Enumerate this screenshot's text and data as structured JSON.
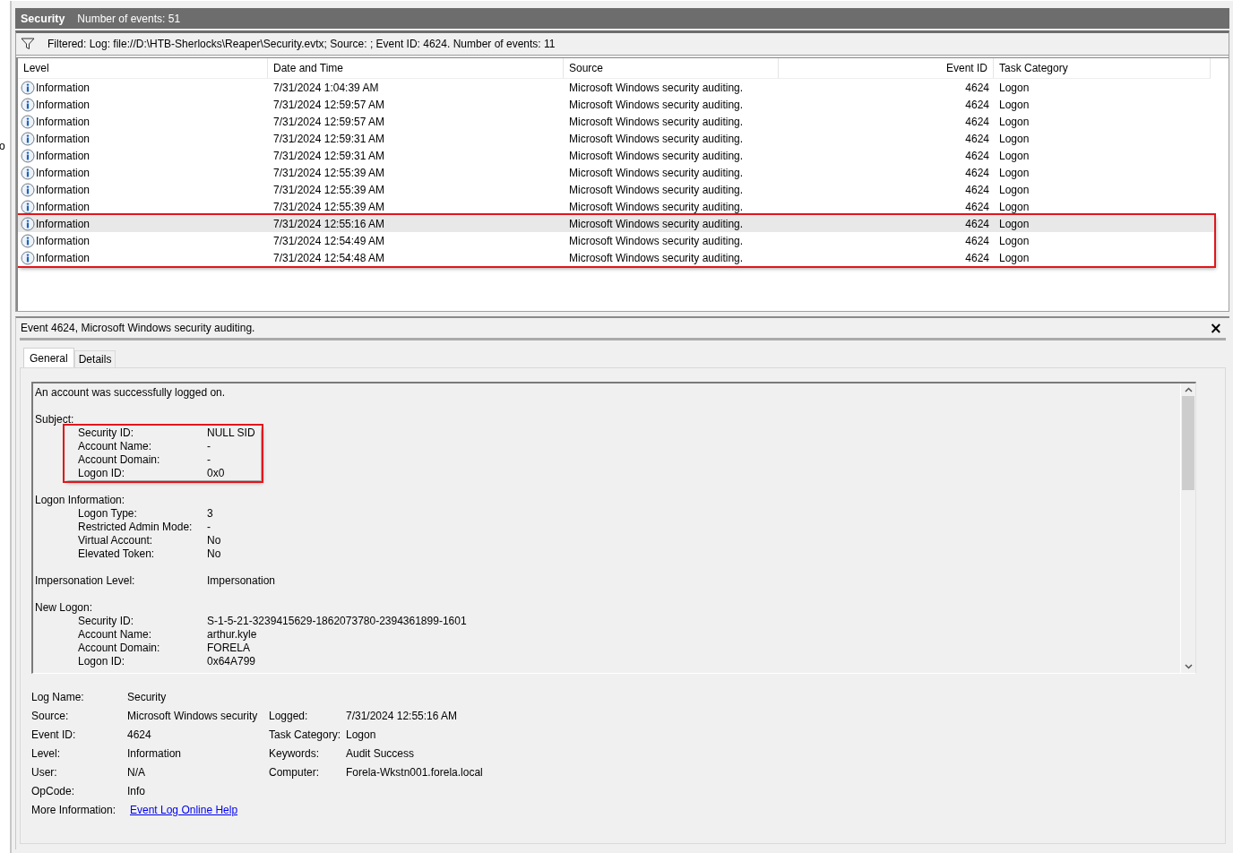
{
  "left_pane": {
    "fragment": "o"
  },
  "log_header": {
    "title": "Security",
    "count": "Number of events: 51"
  },
  "filter_bar": {
    "text": "Filtered: Log: file://D:\\HTB-Sherlocks\\Reaper\\Security.evtx; Source: ; Event ID: 4624. Number of events: 11"
  },
  "table": {
    "columns": [
      "Level",
      "Date and Time",
      "Source",
      "Event ID",
      "Task Category"
    ],
    "rows": [
      {
        "level": "Information",
        "date": "7/31/2024 1:04:39 AM",
        "source": "Microsoft Windows security auditing.",
        "event_id": "4624",
        "category": "Logon",
        "selected": false,
        "highlighted": false
      },
      {
        "level": "Information",
        "date": "7/31/2024 12:59:57 AM",
        "source": "Microsoft Windows security auditing.",
        "event_id": "4624",
        "category": "Logon",
        "selected": false,
        "highlighted": false
      },
      {
        "level": "Information",
        "date": "7/31/2024 12:59:57 AM",
        "source": "Microsoft Windows security auditing.",
        "event_id": "4624",
        "category": "Logon",
        "selected": false,
        "highlighted": false
      },
      {
        "level": "Information",
        "date": "7/31/2024 12:59:31 AM",
        "source": "Microsoft Windows security auditing.",
        "event_id": "4624",
        "category": "Logon",
        "selected": false,
        "highlighted": false
      },
      {
        "level": "Information",
        "date": "7/31/2024 12:59:31 AM",
        "source": "Microsoft Windows security auditing.",
        "event_id": "4624",
        "category": "Logon",
        "selected": false,
        "highlighted": false
      },
      {
        "level": "Information",
        "date": "7/31/2024 12:55:39 AM",
        "source": "Microsoft Windows security auditing.",
        "event_id": "4624",
        "category": "Logon",
        "selected": false,
        "highlighted": false
      },
      {
        "level": "Information",
        "date": "7/31/2024 12:55:39 AM",
        "source": "Microsoft Windows security auditing.",
        "event_id": "4624",
        "category": "Logon",
        "selected": false,
        "highlighted": false
      },
      {
        "level": "Information",
        "date": "7/31/2024 12:55:39 AM",
        "source": "Microsoft Windows security auditing.",
        "event_id": "4624",
        "category": "Logon",
        "selected": false,
        "highlighted": false
      },
      {
        "level": "Information",
        "date": "7/31/2024 12:55:16 AM",
        "source": "Microsoft Windows security auditing.",
        "event_id": "4624",
        "category": "Logon",
        "selected": true,
        "highlighted": true
      },
      {
        "level": "Information",
        "date": "7/31/2024 12:54:49 AM",
        "source": "Microsoft Windows security auditing.",
        "event_id": "4624",
        "category": "Logon",
        "selected": false,
        "highlighted": true
      },
      {
        "level": "Information",
        "date": "7/31/2024 12:54:48 AM",
        "source": "Microsoft Windows security auditing.",
        "event_id": "4624",
        "category": "Logon",
        "selected": false,
        "highlighted": true
      }
    ]
  },
  "detail": {
    "title": "Event 4624, Microsoft Windows security auditing.",
    "close": "×",
    "tabs": [
      {
        "label": "General",
        "selected": true
      },
      {
        "label": "Details",
        "selected": false
      }
    ],
    "description": {
      "intro": "An account was successfully logged on.",
      "blocks": [
        {
          "kind": "group",
          "title": "Subject:",
          "highlighted": true,
          "fields": [
            {
              "label": "Security ID:",
              "value": "NULL SID"
            },
            {
              "label": "Account Name:",
              "value": "-"
            },
            {
              "label": "Account Domain:",
              "value": "-"
            },
            {
              "label": "Logon ID:",
              "value": "0x0"
            }
          ]
        },
        {
          "kind": "group",
          "title": "Logon Information:",
          "highlighted": false,
          "fields": [
            {
              "label": "Logon Type:",
              "value": "3"
            },
            {
              "label": "Restricted Admin Mode:",
              "value": "-"
            },
            {
              "label": "Virtual Account:",
              "value": "No"
            },
            {
              "label": "Elevated Token:",
              "value": "No"
            }
          ]
        },
        {
          "kind": "field",
          "label": "Impersonation Level:",
          "value": "Impersonation"
        },
        {
          "kind": "group",
          "title": "New Logon:",
          "highlighted": false,
          "fields": [
            {
              "label": "Security ID:",
              "value": "S-1-5-21-3239415629-1862073780-2394361899-1601"
            },
            {
              "label": "Account Name:",
              "value": "arthur.kyle"
            },
            {
              "label": "Account Domain:",
              "value": "FORELA"
            },
            {
              "label": "Logon ID:",
              "value": "0x64A799"
            }
          ]
        }
      ]
    },
    "properties": [
      {
        "label": "Log Name:",
        "value": "Security"
      },
      {
        "label": "Source:",
        "value": "Microsoft Windows security",
        "label_2": "Logged:",
        "value_2": "7/31/2024 12:55:16 AM"
      },
      {
        "label": "Event ID:",
        "value": "4624",
        "label_2": "Task Category:",
        "value_2": "Logon"
      },
      {
        "label": "Level:",
        "value": "Information",
        "label_2": "Keywords:",
        "value_2": "Audit Success"
      },
      {
        "label": "User:",
        "value": "N/A",
        "label_2": "Computer:",
        "value_2": "Forela-Wkstn001.forela.local"
      },
      {
        "label": "OpCode:",
        "value": "Info"
      },
      {
        "label": "More Information:",
        "link": "Event Log Online Help"
      }
    ]
  }
}
